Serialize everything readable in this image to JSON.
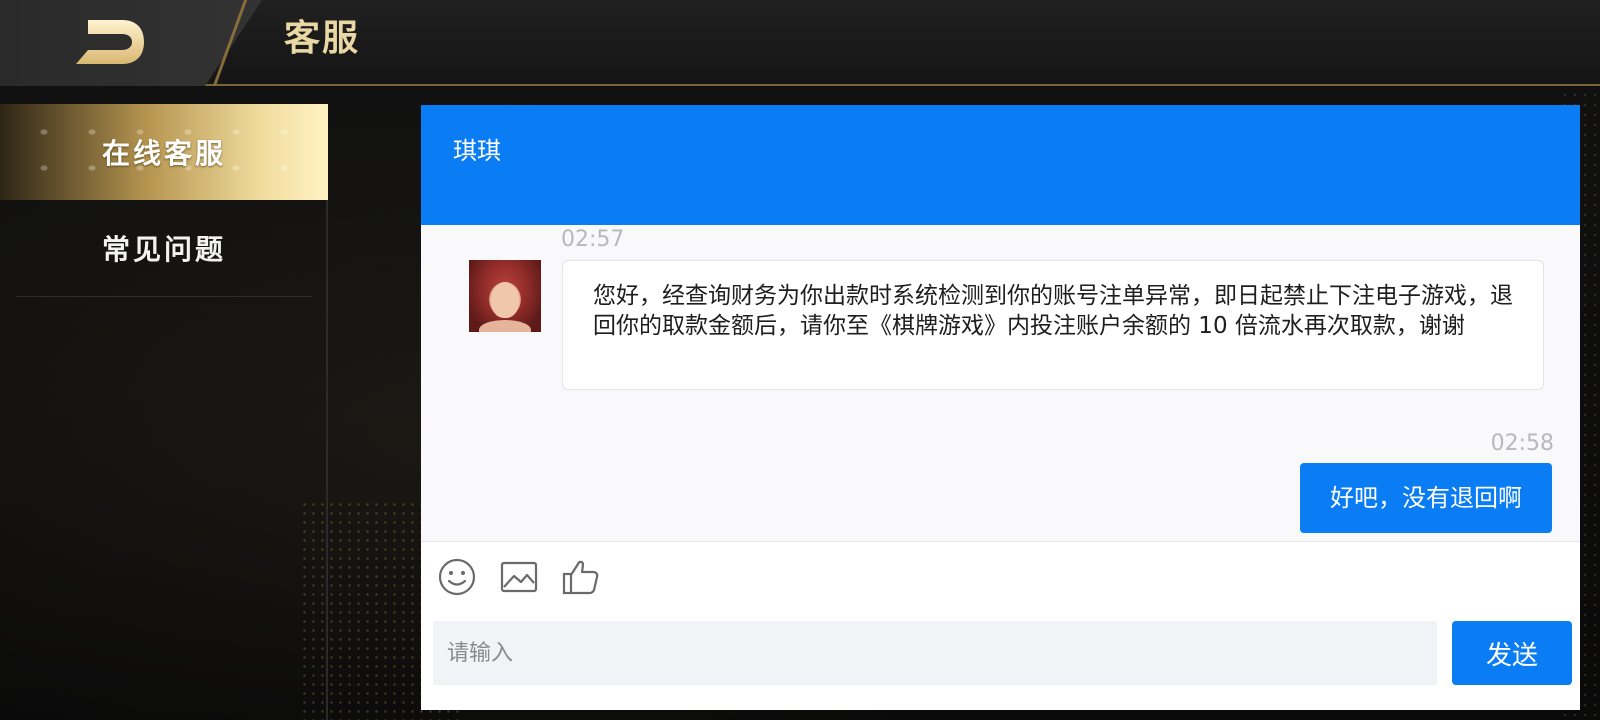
{
  "header": {
    "title": "客服",
    "back_icon": "back-arrow-icon"
  },
  "sidebar": {
    "items": [
      {
        "label": "在线客服",
        "active": true
      },
      {
        "label": "常见问题",
        "active": false
      }
    ]
  },
  "chat": {
    "agent_name": "琪琪",
    "messages": [
      {
        "direction": "incoming",
        "time": "02:57",
        "text": "您好，经查询财务为你出款时系统检测到你的账号注单异常，即日起禁止下注电子游戏，退回你的取款金额后，请你至《棋牌游戏》内投注账户余额的 10 倍流水再次取款，谢谢"
      },
      {
        "direction": "outgoing",
        "time": "02:58",
        "text": "好吧，没有退回啊"
      }
    ],
    "toolbar": {
      "icons": [
        "emoji-icon",
        "image-icon",
        "thumbs-up-icon"
      ]
    },
    "input": {
      "placeholder": "请输入",
      "value": ""
    },
    "send_label": "发送"
  },
  "colors": {
    "accent_blue": "#0a7cf4",
    "gold": "#e9d7a4"
  }
}
